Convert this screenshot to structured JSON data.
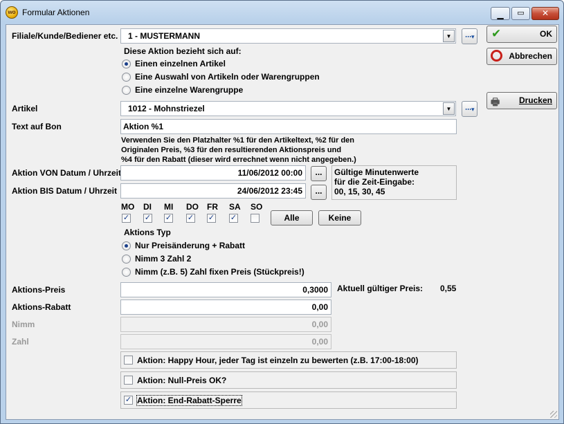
{
  "window": {
    "title": "Formular Aktionen",
    "icon_label": "wo"
  },
  "filiale": {
    "label": "Filiale/Kunde/Bediener etc.",
    "value": "1 - MUSTERMANN"
  },
  "bezieht": {
    "heading": "Diese Aktion bezieht sich auf:",
    "options": [
      {
        "label": "Einen einzelnen Artikel",
        "selected": true
      },
      {
        "label": "Eine Auswahl von Artikeln oder Warengruppen",
        "selected": false
      },
      {
        "label": "Eine einzelne Warengruppe",
        "selected": false
      }
    ]
  },
  "artikel": {
    "label": "Artikel",
    "value": "1012 - Mohnstriezel"
  },
  "bon": {
    "label": "Text auf Bon",
    "value": "Aktion %1",
    "note": [
      "Verwenden Sie den Platzhalter %1 für den Artikeltext, %2 für den",
      "Originalen Preis, %3 für den resultierenden Aktionspreis und",
      "%4 für den Rabatt (dieser wird errechnet wenn nicht angegeben.)"
    ]
  },
  "von": {
    "label": "Aktion VON Datum / Uhrzeit",
    "value": "11/06/2012 00:00",
    "btn": "..."
  },
  "bis": {
    "label": "Aktion BIS Datum / Uhrzeit",
    "value": "24/06/2012 23:45",
    "btn": "..."
  },
  "minutes": {
    "line1": "Gültige Minutenwerte",
    "line2": "für die Zeit-Eingabe:",
    "line3": "00,   15,   30,   45"
  },
  "days": [
    {
      "label": "MO",
      "checked": true
    },
    {
      "label": "DI",
      "checked": true
    },
    {
      "label": "MI",
      "checked": true
    },
    {
      "label": "DO",
      "checked": true
    },
    {
      "label": "FR",
      "checked": true
    },
    {
      "label": "SA",
      "checked": true
    },
    {
      "label": "SO",
      "checked": false
    }
  ],
  "day_buttons": {
    "all": "Alle",
    "none": "Keine"
  },
  "typ": {
    "heading": "Aktions Typ",
    "options": [
      {
        "label": "Nur Preisänderung + Rabatt",
        "selected": true
      },
      {
        "label": "Nimm 3 Zahl 2",
        "selected": false
      },
      {
        "label": "Nimm (z.B. 5) Zahl fixen Preis (Stückpreis!)",
        "selected": false
      }
    ]
  },
  "preis": {
    "label": "Aktions-Preis",
    "value": "0,3000",
    "current_label": "Aktuell gültiger Preis:",
    "current_value": "0,55"
  },
  "rabatt": {
    "label": "Aktions-Rabatt",
    "value": "0,00"
  },
  "nimm": {
    "label": "Nimm",
    "value": "0,00"
  },
  "zahl": {
    "label": "Zahl",
    "value": "0,00"
  },
  "checks": [
    {
      "label": "Aktion: Happy Hour, jeder Tag ist einzeln zu bewerten (z.B. 17:00-18:00)",
      "checked": false
    },
    {
      "label": "Aktion: Null-Preis OK?",
      "checked": false
    },
    {
      "label": "Aktion: End-Rabatt-Sperre",
      "checked": true
    }
  ],
  "side": {
    "ok": "OK",
    "cancel": "Abbrechen",
    "print": "Drucken"
  },
  "colors": {
    "ok_check": "#2e9a1e",
    "cancel_red": "#c8201a",
    "accent": "#1a3f8a"
  }
}
